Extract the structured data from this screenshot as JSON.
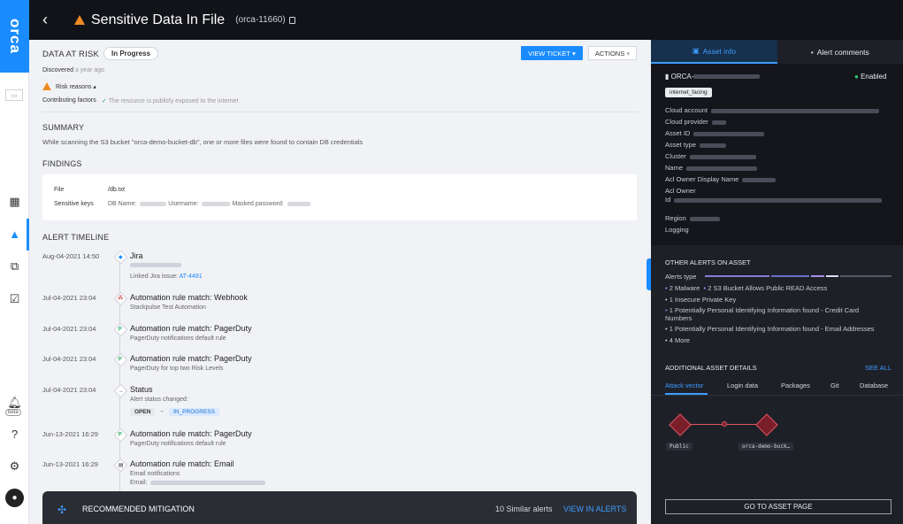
{
  "sidebar": {
    "logo": "orca",
    "beta": "beta"
  },
  "header": {
    "title": "Sensitive Data In File",
    "alert_id": "(orca-11660)"
  },
  "risk": {
    "title": "DATA AT RISK",
    "status": "In Progress",
    "discovered_label": "Discovered",
    "discovered_value": "a year ago",
    "risk_reasons": "Risk reasons ▴",
    "contributing_label": "Contributing factors",
    "contributing_value": "The resource is publicly exposed to the internet",
    "view_ticket": "VIEW TICKET",
    "actions": "ACTIONS"
  },
  "summary": {
    "title": "SUMMARY",
    "text": "While scanning the S3 bucket \"orca-demo-bucket-db\", one or more files were found to contain DB credentials"
  },
  "findings": {
    "title": "FINDINGS",
    "file_label": "File",
    "file_value": "/db.txt",
    "keys_label": "Sensitive keys",
    "keys_db": "DB Name:",
    "keys_user": "Username:",
    "keys_pass": "Masked password:"
  },
  "timeline": {
    "title": "ALERT TIMELINE",
    "events": [
      {
        "date": "Aug-04-2021 14:50",
        "title": "Jira",
        "sub": "Linked Jira issue:",
        "link": "AT-4481",
        "icon": "jira-icon"
      },
      {
        "date": "Jul-04-2021 23:04",
        "title": "Automation rule match: Webhook",
        "sub": "Stackpulse Test Automation",
        "icon": "webhook-icon"
      },
      {
        "date": "Jul-04-2021 23:04",
        "title": "Automation rule match: PagerDuty",
        "sub": "PagerDuty notifications default rule",
        "icon": "pagerduty-icon"
      },
      {
        "date": "Jul-04-2021 23:04",
        "title": "Automation rule match: PagerDuty",
        "sub": "PagerDuty for top two Risk Levels",
        "icon": "pagerduty-icon"
      },
      {
        "date": "Jul-04-2021 23:04",
        "title": "Status",
        "sub": "Alert status changed:",
        "from": "OPEN",
        "to": "IN_PROGRESS",
        "icon": "arrow-right-icon"
      },
      {
        "date": "Jun-13-2021 16:29",
        "title": "Automation rule match: PagerDuty",
        "sub": "PagerDuty notifications default rule",
        "icon": "pagerduty-icon"
      },
      {
        "date": "Jun-13-2021 16:29",
        "title": "Automation rule match: Email",
        "sub": "Email notifications",
        "sub2": "Email:",
        "icon": "email-icon"
      }
    ]
  },
  "mitigation": {
    "title": "RECOMMENDED MITIGATION",
    "similar": "10 Similar alerts",
    "view": "VIEW IN ALERTS"
  },
  "right": {
    "tab_asset": "Asset info",
    "tab_comments": "Alert comments",
    "asset_name": "ORCA-",
    "enabled": "Enabled",
    "tag": "internet_facing",
    "fields": [
      "Cloud account",
      "Cloud provider",
      "Asset ID",
      "Asset type",
      "Cluster",
      "Name",
      "Acl Owner Display Name",
      "Acl Owner",
      "Id",
      "Region",
      "Logging"
    ],
    "other_title": "OTHER ALERTS ON ASSET",
    "alerts_type": "Alerts type",
    "alerts": [
      "2 Malware",
      "2 S3 Bucket Allows Public READ Access",
      "1 Insecure Private Key",
      "1 Potentially Personal Identifying Information found - Credit Card Numbers",
      "1 Potentially Personal Identifying Information found - Email Addresses",
      "4 More"
    ],
    "additional_title": "ADDITIONAL ASSET DETAILS",
    "see_all": "SEE ALL",
    "sub_tabs": [
      "Attack vector",
      "Login data",
      "Packages",
      "Git",
      "Database"
    ],
    "node_public": "Public",
    "node_bucket": "orca-demo-buck…",
    "goto": "GO TO ASSET PAGE"
  },
  "colors": {
    "accent": "#1a8cff",
    "warning": "#f08a24",
    "dark": "#1e2028",
    "node": "#e05561"
  }
}
